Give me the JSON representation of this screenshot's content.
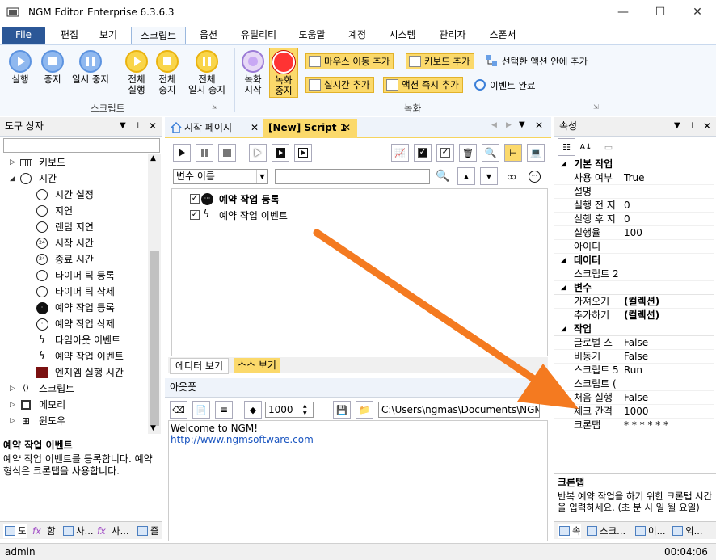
{
  "window": {
    "app_name": "NGM Editor",
    "edition": "Enterprise 6.3.6.3"
  },
  "menu": {
    "items": [
      "File",
      "편집",
      "보기",
      "스크립트",
      "옵션",
      "유틸리티",
      "도움말",
      "계정",
      "시스템",
      "관리자",
      "스폰서"
    ],
    "active": "스크립트"
  },
  "ribbon": {
    "script_group": {
      "label": "스크립트",
      "buttons": [
        "실행",
        "중지",
        "일시 중지"
      ],
      "all_buttons": [
        [
          "전체",
          "실행"
        ],
        [
          "전체",
          "중지"
        ],
        [
          "전체",
          "일시 중지"
        ]
      ]
    },
    "record_group": {
      "label": "녹화",
      "record_start": [
        "녹화",
        "시작"
      ],
      "record_stop": [
        "녹화",
        "중지"
      ],
      "add_mouse": "마우스 이동 추가",
      "add_keyboard": "키보드 추가",
      "add_in_selected": "선택한 액션 안에 추가",
      "add_realtime": "실시간 추가",
      "add_action_now": "액션 즉시 추가",
      "event_done": "이벤트 완료"
    }
  },
  "toolbox": {
    "title": "도구 상자",
    "items": [
      {
        "label": "키보드",
        "level": 0,
        "icon": "keyboard-icon",
        "expand": "▷"
      },
      {
        "label": "시간",
        "level": 0,
        "icon": "alarm-clock-icon",
        "expand": "◢"
      },
      {
        "label": "시간 설정",
        "level": 1,
        "icon": "clock-icon"
      },
      {
        "label": "지연",
        "level": 1,
        "icon": "timer-icon"
      },
      {
        "label": "랜덤 지연",
        "level": 1,
        "icon": "timer-icon"
      },
      {
        "label": "시작 시간",
        "level": 1,
        "icon": "24h-clock-icon"
      },
      {
        "label": "종료 시간",
        "level": 1,
        "icon": "24h-clock-icon"
      },
      {
        "label": "타이머 틱 등록",
        "level": 1,
        "icon": "alarm-clock-icon"
      },
      {
        "label": "타이머 틱 삭제",
        "level": 1,
        "icon": "alarm-clock-icon"
      },
      {
        "label": "예약 작업 등록",
        "level": 1,
        "icon": "schedule-filled-icon"
      },
      {
        "label": "예약 작업 삭제",
        "level": 1,
        "icon": "schedule-outline-icon"
      },
      {
        "label": "타임아웃 이벤트",
        "level": 1,
        "icon": "lightning-icon"
      },
      {
        "label": "예약 작업 이벤트",
        "level": 1,
        "icon": "lightning-icon"
      },
      {
        "label": "엔지엠 실행 시간",
        "level": 1,
        "icon": "ngm-icon"
      },
      {
        "label": "스크립트",
        "level": 0,
        "icon": "code-icon",
        "expand": "▷"
      },
      {
        "label": "메모리",
        "level": 0,
        "icon": "memory-icon",
        "expand": "▷"
      },
      {
        "label": "윈도우",
        "level": 0,
        "icon": "windows-icon",
        "expand": "▷"
      }
    ],
    "desc_title": "예약 작업 이벤트",
    "desc_text": "예약 작업 이벤트를 등록합니다. 예약 형식은 크론탭을 사용합니다.",
    "bottom_tabs": [
      "도",
      "함",
      "사...",
      "사...",
      "즐"
    ]
  },
  "editor": {
    "tabs": [
      "시작 페이지",
      "[New] Script 1"
    ],
    "active_tab": "[New] Script 1",
    "variable_combo": "변수 이름",
    "script_items": [
      "예약 작업 등록",
      "예약 작업 이벤트"
    ],
    "view_tabs": [
      "에디터 보기",
      "소스 보기"
    ]
  },
  "output": {
    "title": "아웃풋",
    "count_value": "1000",
    "path_value": "C:\\Users\\ngmas\\Documents\\NGM6\\",
    "lines": [
      "Welcome to NGM!"
    ],
    "link": "http://www.ngmsoftware.com"
  },
  "properties": {
    "title": "속성",
    "rows": [
      {
        "type": "cat",
        "key": "기본 작업"
      },
      {
        "type": "row",
        "key": "사용 여부",
        "value": "True"
      },
      {
        "type": "row",
        "key": "설명",
        "value": ""
      },
      {
        "type": "row",
        "key": "실행 전 지",
        "value": "0"
      },
      {
        "type": "row",
        "key": "실행 후 지",
        "value": "0"
      },
      {
        "type": "row",
        "key": "실행율",
        "value": "100"
      },
      {
        "type": "row",
        "key": "아이디",
        "value": ""
      },
      {
        "type": "cat",
        "key": "데이터"
      },
      {
        "type": "row",
        "key": "스크립트 2",
        "value": ""
      },
      {
        "type": "cat",
        "key": "변수"
      },
      {
        "type": "row",
        "key": "가져오기",
        "value": "(컬렉션)",
        "bold": true
      },
      {
        "type": "row",
        "key": "추가하기",
        "value": "(컬렉션)",
        "bold": true
      },
      {
        "type": "cat",
        "key": "작업"
      },
      {
        "type": "row",
        "key": "글로벌 스",
        "value": "False"
      },
      {
        "type": "row",
        "key": "비동기",
        "value": "False"
      },
      {
        "type": "row",
        "key": "스크립트 5",
        "value": "Run"
      },
      {
        "type": "row",
        "key": "스크립트 (",
        "value": ""
      },
      {
        "type": "row",
        "key": "처음 실행",
        "value": "False"
      },
      {
        "type": "row",
        "key": "체크 간격",
        "value": "1000"
      },
      {
        "type": "row",
        "key": "크론탭",
        "value": "* * * * * *"
      }
    ],
    "desc_title": "크론탭",
    "desc_text": "반복 예약 작업을 하기 위한 크론탭 시간을 입력하세요. (초 분 시 일 월 요일)",
    "bottom_tabs": [
      "속",
      "스크...",
      "이...",
      "외..."
    ]
  },
  "status": {
    "user": "admin",
    "time": "00:04:06"
  },
  "colors": {
    "accent": "#2b5797",
    "arrow": "#f47a20",
    "highlight": "#fbd96b"
  }
}
